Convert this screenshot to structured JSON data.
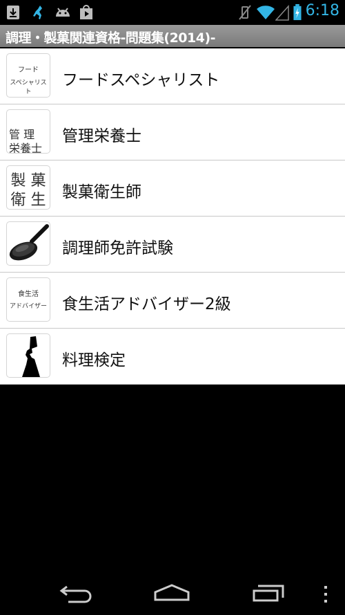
{
  "status": {
    "time": "6:18"
  },
  "title": "調理・製菓関連資格-問題集(2014)-",
  "items": [
    {
      "label": "フードスペシャリスト",
      "thumb": {
        "line1": "フード",
        "line2": "スペシャリスト"
      }
    },
    {
      "label": "管理栄養士",
      "thumb": {
        "line1": "管 理",
        "line2": "栄養士"
      }
    },
    {
      "label": "製菓衛生師",
      "thumb": {
        "line1": "製 菓",
        "line2": "衛 生"
      }
    },
    {
      "label": "調理師免許試験",
      "thumb": {
        "icon": "frying-pan"
      }
    },
    {
      "label": "食生活アドバイザー2級",
      "thumb": {
        "line1": "食生活",
        "line2": "アドバイザー"
      }
    },
    {
      "label": "料理検定",
      "thumb": {
        "icon": "chef-silhouette"
      }
    }
  ],
  "colors": {
    "accent": "#33b5e5",
    "title_bar": "#8a8a8a"
  }
}
